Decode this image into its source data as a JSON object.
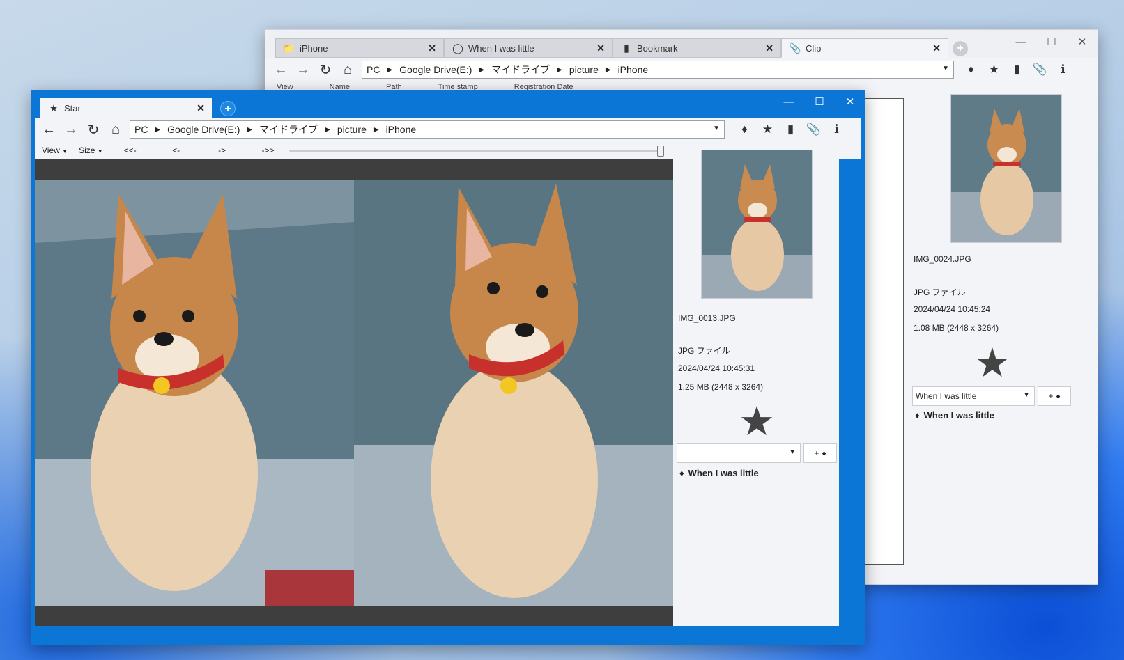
{
  "back_window": {
    "tabs": [
      {
        "icon": "folder-icon",
        "label": "iPhone"
      },
      {
        "icon": "tag-icon",
        "label": "When I was little"
      },
      {
        "icon": "bookmark-icon",
        "label": "Bookmark"
      },
      {
        "icon": "paperclip-icon",
        "label": "Clip"
      }
    ],
    "breadcrumbs": [
      "PC",
      "Google Drive(E:)",
      "マイドライブ",
      "picture",
      "iPhone"
    ],
    "columns": [
      "View",
      "Name",
      "Path",
      "Time stamp",
      "Registration Date"
    ],
    "info": {
      "filename": "IMG_0024.JPG",
      "filetype": "JPG ファイル",
      "timestamp": "2024/04/24 10:45:24",
      "size": "1.08 MB (2448 x 3264)",
      "tag_select_value": "When I was little",
      "tag_add_label": "+",
      "tag_chip": "When I was little"
    }
  },
  "front_window": {
    "tab": {
      "icon": "star-icon",
      "label": "Star"
    },
    "breadcrumbs": [
      "PC",
      "Google Drive(E:)",
      "マイドライブ",
      "picture",
      "iPhone"
    ],
    "viewbar": {
      "view_label": "View",
      "size_label": "Size",
      "first_label": "<<-",
      "prev_label": "<-",
      "next_label": "->",
      "last_label": "->>"
    },
    "slider_value": 1.0,
    "info": {
      "filename": "IMG_0013.JPG",
      "filetype": "JPG ファイル",
      "timestamp": "2024/04/24 10:45:31",
      "size": "1.25 MB (2448 x 3264)",
      "tag_select_value": "",
      "tag_add_label": "+",
      "tag_chip": "When I was little"
    }
  },
  "colors": {
    "accent": "#0b76d6",
    "viewer_bg": "#3e3e3e",
    "panel_bg": "#f3f4f8"
  }
}
